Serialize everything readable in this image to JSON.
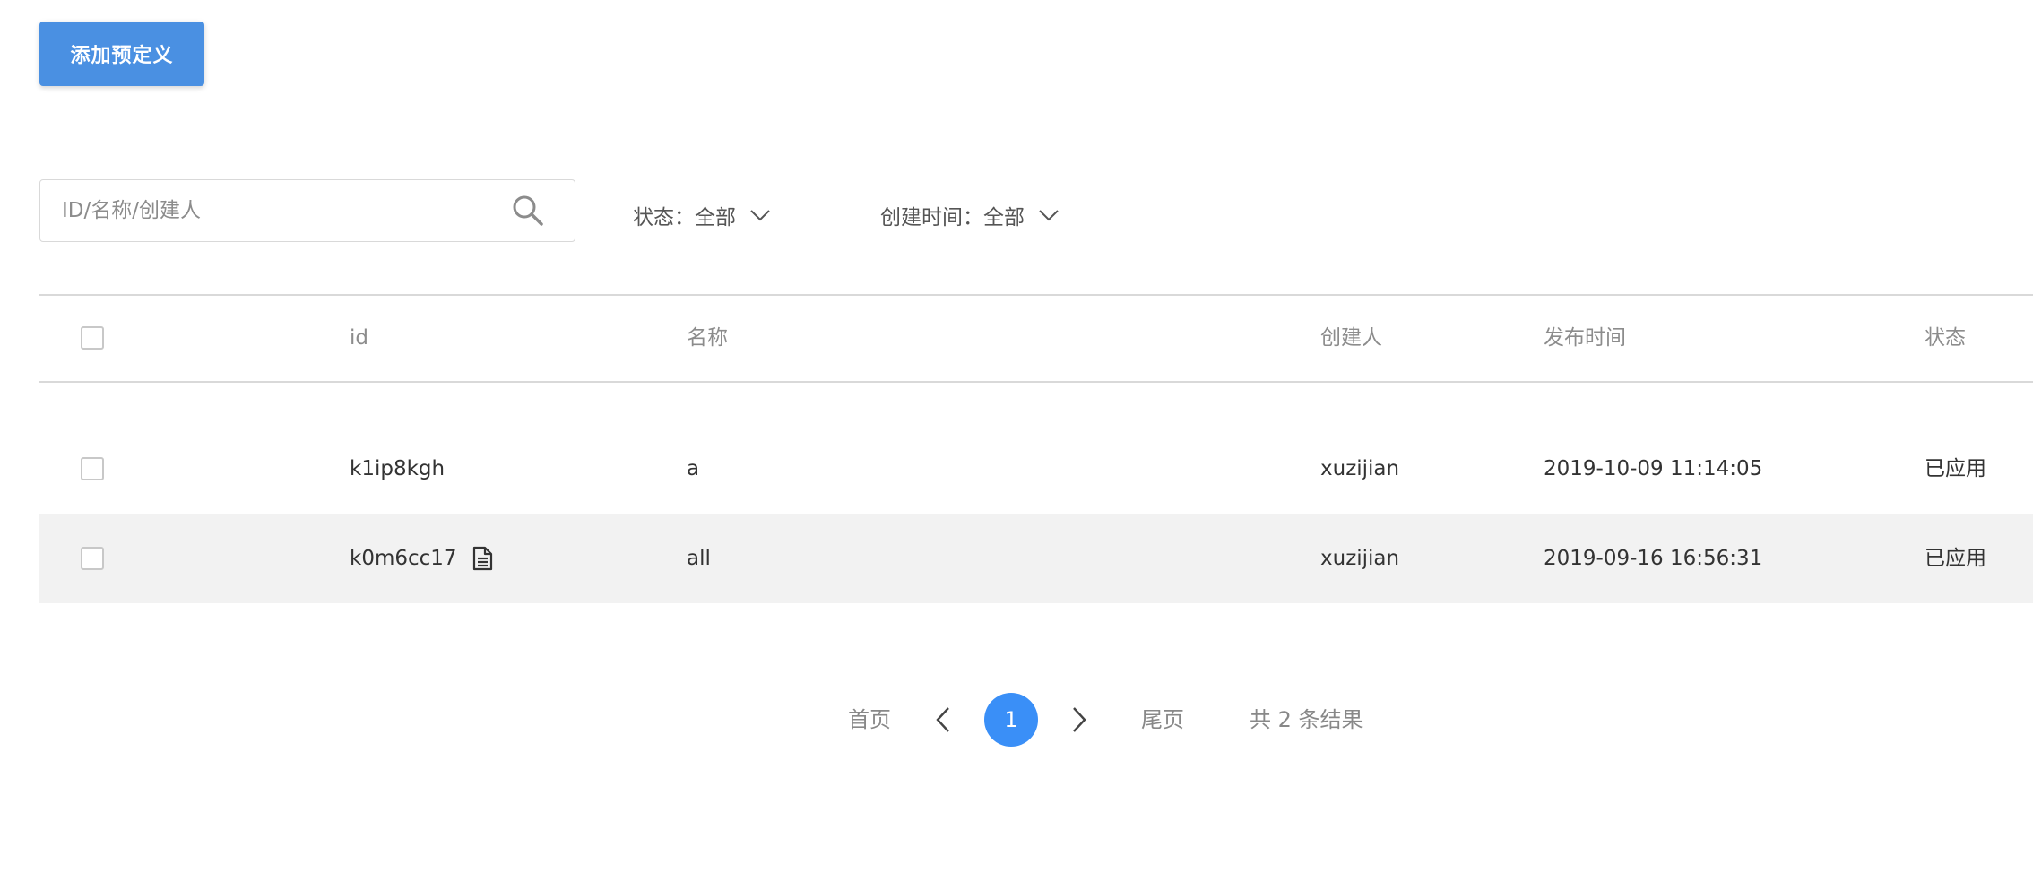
{
  "toolbar": {
    "add_label": "添加预定义"
  },
  "search": {
    "placeholder": "ID/名称/创建人",
    "value": ""
  },
  "filters": {
    "status": {
      "label": "状态：全部"
    },
    "created_time": {
      "label": "创建时间：全部"
    }
  },
  "table": {
    "headers": {
      "id": "id",
      "name": "名称",
      "creator": "创建人",
      "publish_time": "发布时间",
      "status": "状态"
    },
    "rows": [
      {
        "id": "k1ip8kgh",
        "name": "a",
        "creator": "xuzijian",
        "publish_time": "2019-10-09 11:14:05",
        "status": "已应用",
        "has_doc_icon": false
      },
      {
        "id": "k0m6cc17",
        "name": "all",
        "creator": "xuzijian",
        "publish_time": "2019-09-16 16:56:31",
        "status": "已应用",
        "has_doc_icon": true
      }
    ]
  },
  "pagination": {
    "first_label": "首页",
    "last_label": "尾页",
    "current_page": "1",
    "summary": "共 2 条结果"
  },
  "icons": {
    "search": "search-icon",
    "chevron": "chevron-down-icon",
    "doc": "document-icon",
    "prev": "chevron-left-icon",
    "next": "chevron-right-icon"
  },
  "colors": {
    "primary": "#4a90e2",
    "page_active": "#3a8ff7",
    "row_highlight": "#f2f2f2"
  }
}
